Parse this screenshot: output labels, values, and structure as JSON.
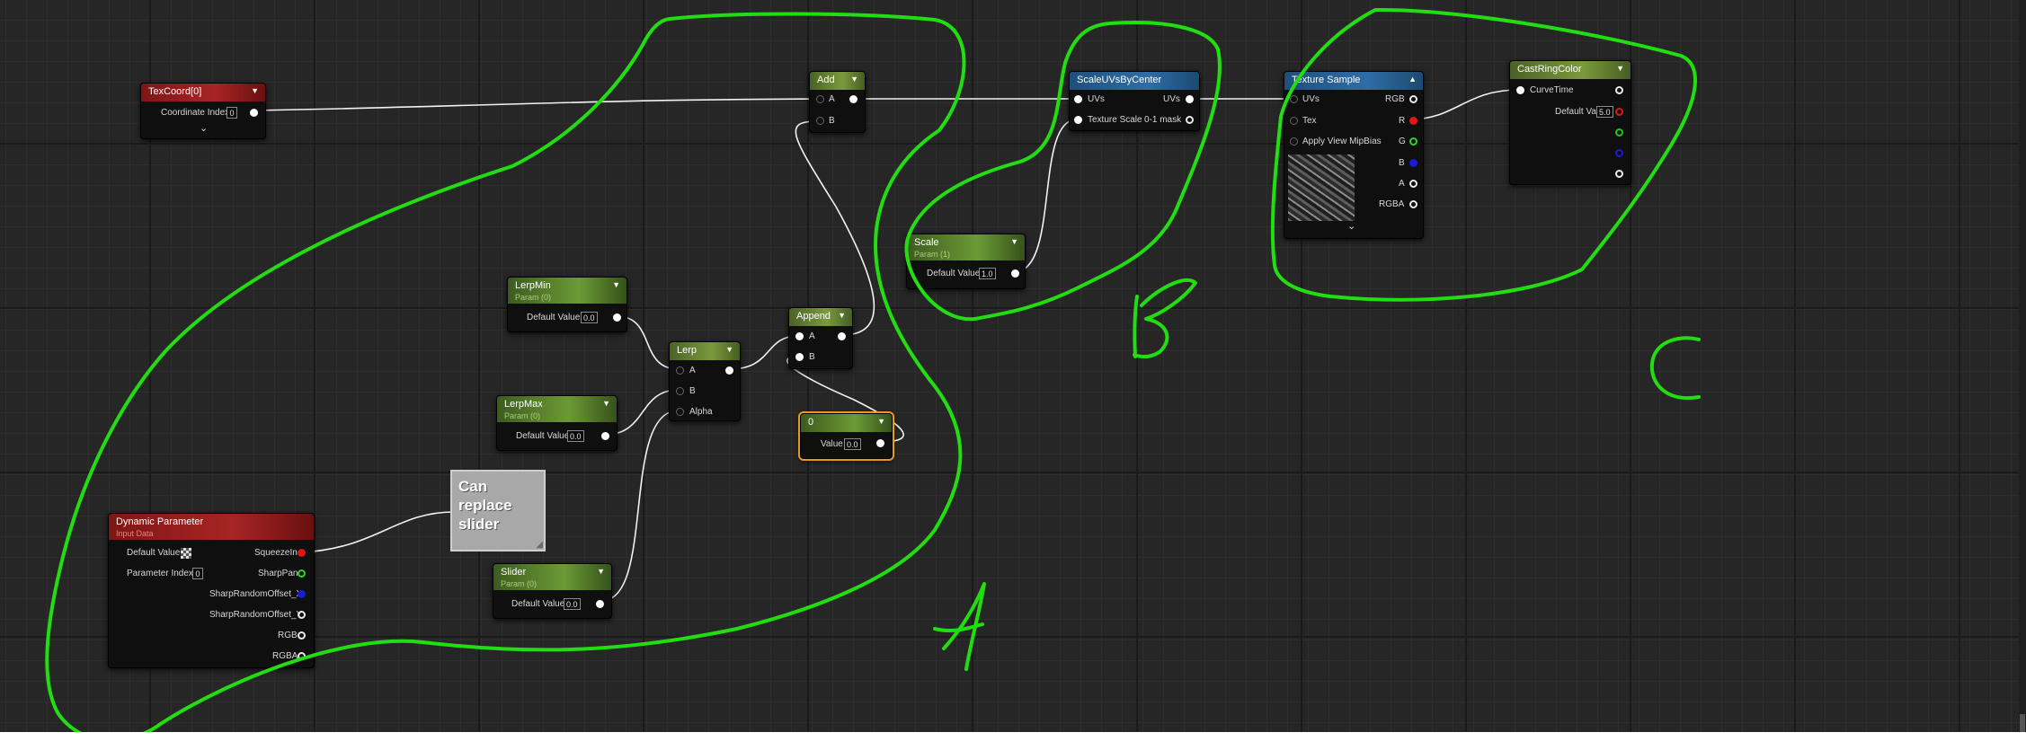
{
  "nodes": {
    "texcoord": {
      "title": "TexCoord[0]",
      "label": "Coordinate Index",
      "value": "0"
    },
    "add": {
      "title": "Add",
      "pin_a": "A",
      "pin_b": "B"
    },
    "scale_uvs": {
      "title": "ScaleUVsByCenter",
      "in_uvs": "UVs",
      "in_scale": "Texture Scale",
      "out_uvs": "UVs",
      "out_mask": "0-1 mask"
    },
    "texture_sample": {
      "title": "Texture Sample",
      "in_uvs": "UVs",
      "in_tex": "Tex",
      "mipbias": "Apply View MipBias",
      "out_rgb": "RGB",
      "out_r": "R",
      "out_g": "G",
      "out_b": "B",
      "out_a": "A",
      "out_rgba": "RGBA"
    },
    "cast_ring": {
      "title": "CastRingColor",
      "pin": "CurveTime",
      "label": "Default Value",
      "value": "5.0"
    },
    "scale": {
      "title": "Scale",
      "subtitle": "Param (1)",
      "label": "Default Value",
      "value": "1.0"
    },
    "lerpmin": {
      "title": "LerpMin",
      "subtitle": "Param (0)",
      "label": "Default Value",
      "value": "0.0"
    },
    "lerp": {
      "title": "Lerp",
      "pin_a": "A",
      "pin_b": "B",
      "pin_alpha": "Alpha"
    },
    "append": {
      "title": "Append",
      "pin_a": "A",
      "pin_b": "B"
    },
    "lerpmax": {
      "title": "LerpMax",
      "subtitle": "Param (0)",
      "label": "Default Value",
      "value": "0.0"
    },
    "zero": {
      "title": "0",
      "label": "Value",
      "value": "0.0"
    },
    "dynamic": {
      "title": "Dynamic Parameter",
      "subtitle": "Input Data",
      "default_label": "Default Value",
      "index_label": "Parameter Index",
      "index_value": "0",
      "out_squeeze": "SqueezeIn",
      "out_sharppan": "SharpPan",
      "out_offx": "SharpRandomOffset_X",
      "out_offy": "SharpRandomOffset_Y",
      "out_rgb": "RGB",
      "out_rgba": "RGBA"
    },
    "slider": {
      "title": "Slider",
      "subtitle": "Param (0)",
      "label": "Default Value",
      "value": "0.0"
    }
  },
  "comment": {
    "text": "Can replace slider"
  },
  "annotations": {
    "a": "A",
    "b": "B",
    "c": "C"
  },
  "colors": {
    "annotation_stroke": "#22dd11",
    "graph_background": "#262626",
    "selection": "#e89a1c"
  }
}
